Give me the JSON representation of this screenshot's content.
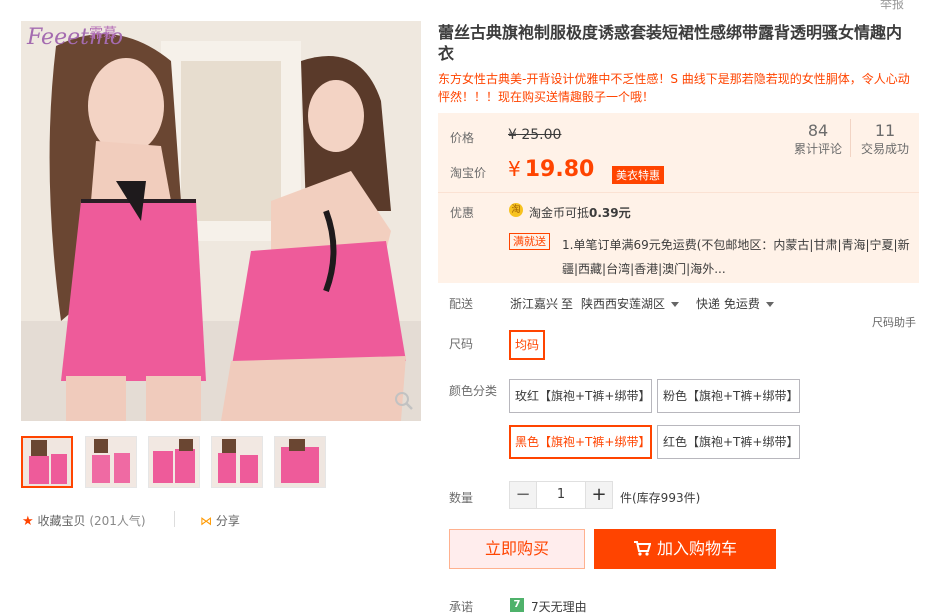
{
  "brand": {
    "logo_text": "Feeetmo",
    "logo_cn": "霏慕"
  },
  "gallery": {
    "zoom_icon": "magnifier-icon",
    "thumb_count": 5
  },
  "share": {
    "favorite_label": "收藏宝贝",
    "favorite_count": "(201人气)",
    "share_label": "分享"
  },
  "top_right_text": "举报",
  "product": {
    "title": "蕾丝古典旗袍制服极度诱惑套装短裙性感绑带露背透明骚女情趣内衣",
    "subtitle": "东方女性古典美-开背设计优雅中不乏性感！S 曲线下是那若隐若现的女性胴体，令人心动怦然！！！现在购买送情趣骰子一个哦！"
  },
  "price": {
    "label": "价格",
    "original": "¥ 25.00",
    "taobao_label": "淘宝价",
    "currency": "¥",
    "current": "19.80",
    "promo_badge": "美衣特惠"
  },
  "stats": [
    {
      "value": "84",
      "label": "累计评论"
    },
    {
      "value": "11",
      "label": "交易成功"
    }
  ],
  "promo": {
    "label": "优惠",
    "coin_icon_text": "淘",
    "coin_text": "淘金币可抵",
    "coin_amount": "0.39元",
    "tag": "满就送",
    "line1": "1.单笔订单满69元免运费(不包邮地区：内蒙古|甘肃|青海|宁夏|新",
    "line2": "疆|西藏|台湾|香港|澳门|海外..."
  },
  "shipping": {
    "label": "配送",
    "from": "浙江嘉兴",
    "to_word": "至",
    "to": "陕西西安莲湖区",
    "method": "快递 免运费"
  },
  "size_helper": "尺码助手",
  "size": {
    "label": "尺码",
    "options": [
      "均码"
    ]
  },
  "color": {
    "label": "颜色分类",
    "options": [
      "玫红【旗袍+T裤+绑带】",
      "粉色【旗袍+T裤+绑带】",
      "黑色【旗袍+T裤+绑带】",
      "红色【旗袍+T裤+绑带】"
    ],
    "selected": "黑色【旗袍+T裤+绑带】"
  },
  "quantity": {
    "label": "数量",
    "minus": "−",
    "value": "1",
    "plus": "+",
    "stock": "件(库存993件)"
  },
  "actions": {
    "buy_now": "立即购买",
    "add_to_cart": "加入购物车"
  },
  "promise": {
    "label": "承诺",
    "icon_text": "7",
    "text": "7天无理由"
  },
  "colors": {
    "accent": "#ff4400",
    "panel_bg": "#fff2e8"
  }
}
